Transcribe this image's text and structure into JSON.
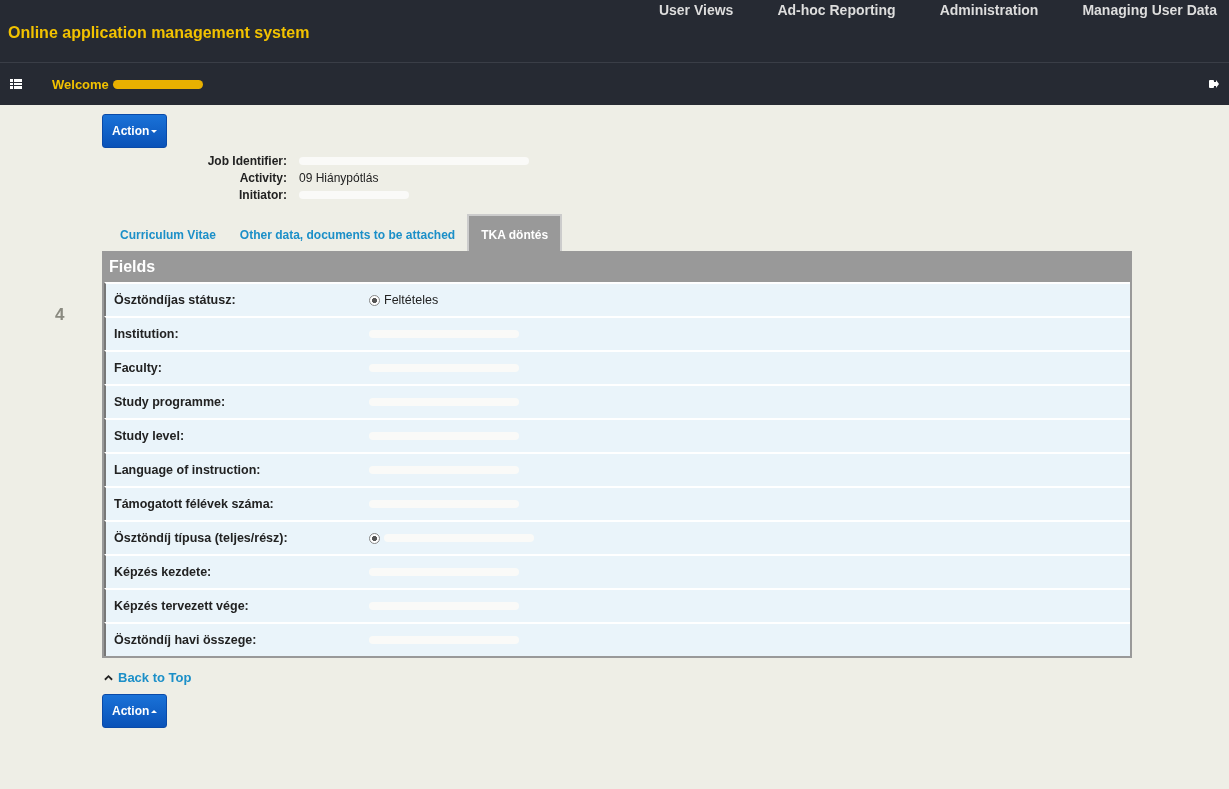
{
  "header": {
    "title": "Online application management system",
    "nav": [
      "User Views",
      "Ad-hoc Reporting",
      "Administration",
      "Managing User Data"
    ],
    "welcome": "Welcome",
    "welcome_redacted": true
  },
  "action_top": "Action",
  "info": [
    {
      "label": "Job Identifier:",
      "redacted": true
    },
    {
      "label": "Activity:",
      "value": "09 Hiánypótlás"
    },
    {
      "label": "Initiator:",
      "redacted": true
    }
  ],
  "tabs": [
    {
      "label": "Curriculum Vitae",
      "selected": false
    },
    {
      "label": "Other data, documents to be attached",
      "selected": false
    },
    {
      "label": "TKA döntés",
      "selected": true
    }
  ],
  "side_number": "4",
  "panel_title": "Fields",
  "fields": [
    {
      "label": "Ösztöndíjas státusz:",
      "kind": "radio",
      "checked": true,
      "value": "Feltételes"
    },
    {
      "label": "Institution:",
      "kind": "text",
      "redacted": true
    },
    {
      "label": "Faculty:",
      "kind": "text",
      "redacted": true
    },
    {
      "label": "Study programme:",
      "kind": "text",
      "redacted": true
    },
    {
      "label": "Study level:",
      "kind": "text",
      "redacted": true
    },
    {
      "label": "Language of instruction:",
      "kind": "text",
      "redacted": true
    },
    {
      "label": "Támogatott félévek száma:",
      "kind": "text",
      "redacted": true
    },
    {
      "label": "Ösztöndíj típusa (teljes/rész):",
      "kind": "radio",
      "checked": true,
      "redacted": true
    },
    {
      "label": "Képzés kezdete:",
      "kind": "text",
      "redacted": true
    },
    {
      "label": "Képzés tervezett vége:",
      "kind": "text",
      "redacted": true
    },
    {
      "label": "Ösztöndíj havi összege:",
      "kind": "text",
      "redacted": true
    }
  ],
  "back_to_top": "Back to Top",
  "action_bottom": "Action"
}
